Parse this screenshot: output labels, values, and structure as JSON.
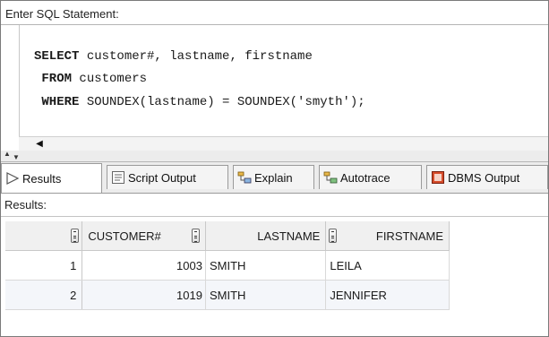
{
  "editor": {
    "header": "Enter SQL Statement:",
    "lines": [
      {
        "keyword": "SELECT",
        "rest": " customer#, lastname, firstname"
      },
      {
        "keyword": "FROM",
        "rest": " customers"
      },
      {
        "keyword": "WHERE",
        "rest": " SOUNDEX(lastname) = SOUNDEX('smyth');"
      }
    ]
  },
  "tabs": [
    {
      "label": "Results",
      "icon": "play-arrow-icon",
      "active": true
    },
    {
      "label": "Script Output",
      "icon": "script-output-icon"
    },
    {
      "label": "Explain",
      "icon": "explain-plan-icon"
    },
    {
      "label": "Autotrace",
      "icon": "autotrace-icon"
    },
    {
      "label": "DBMS Output",
      "icon": "dbms-output-icon"
    }
  ],
  "results": {
    "label": "Results:",
    "columns": [
      "CUSTOMER#",
      "LASTNAME",
      "FIRSTNAME"
    ],
    "rows": [
      {
        "num": "1",
        "cells": [
          "1003",
          "SMITH",
          "LEILA"
        ]
      },
      {
        "num": "2",
        "cells": [
          "1019",
          "SMITH",
          "JENNIFER"
        ]
      }
    ]
  }
}
